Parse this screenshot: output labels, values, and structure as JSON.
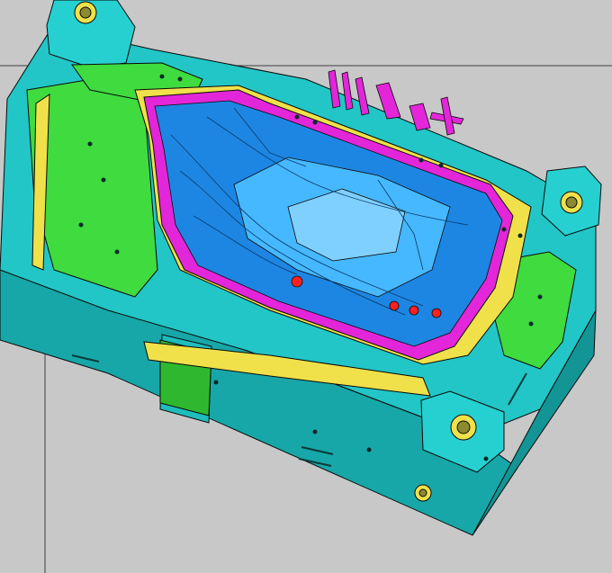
{
  "app": {
    "view": "cad-3d-viewport"
  },
  "model": {
    "type": "injection-mold-cavity",
    "visible_marking_text": "",
    "palette": {
      "background": "#c8c8c8",
      "mold_base": "#22c6c6",
      "mold_base_side": "#18a7a8",
      "insert_green": "#3fdb3f",
      "frame_yellow": "#f0e14a",
      "parting_magenta": "#e326d9",
      "cavity_blue": "#1d86e3",
      "cavity_light": "#46b8ff",
      "marker_red": "#ff2020",
      "edges": "#0a0a0a"
    }
  }
}
